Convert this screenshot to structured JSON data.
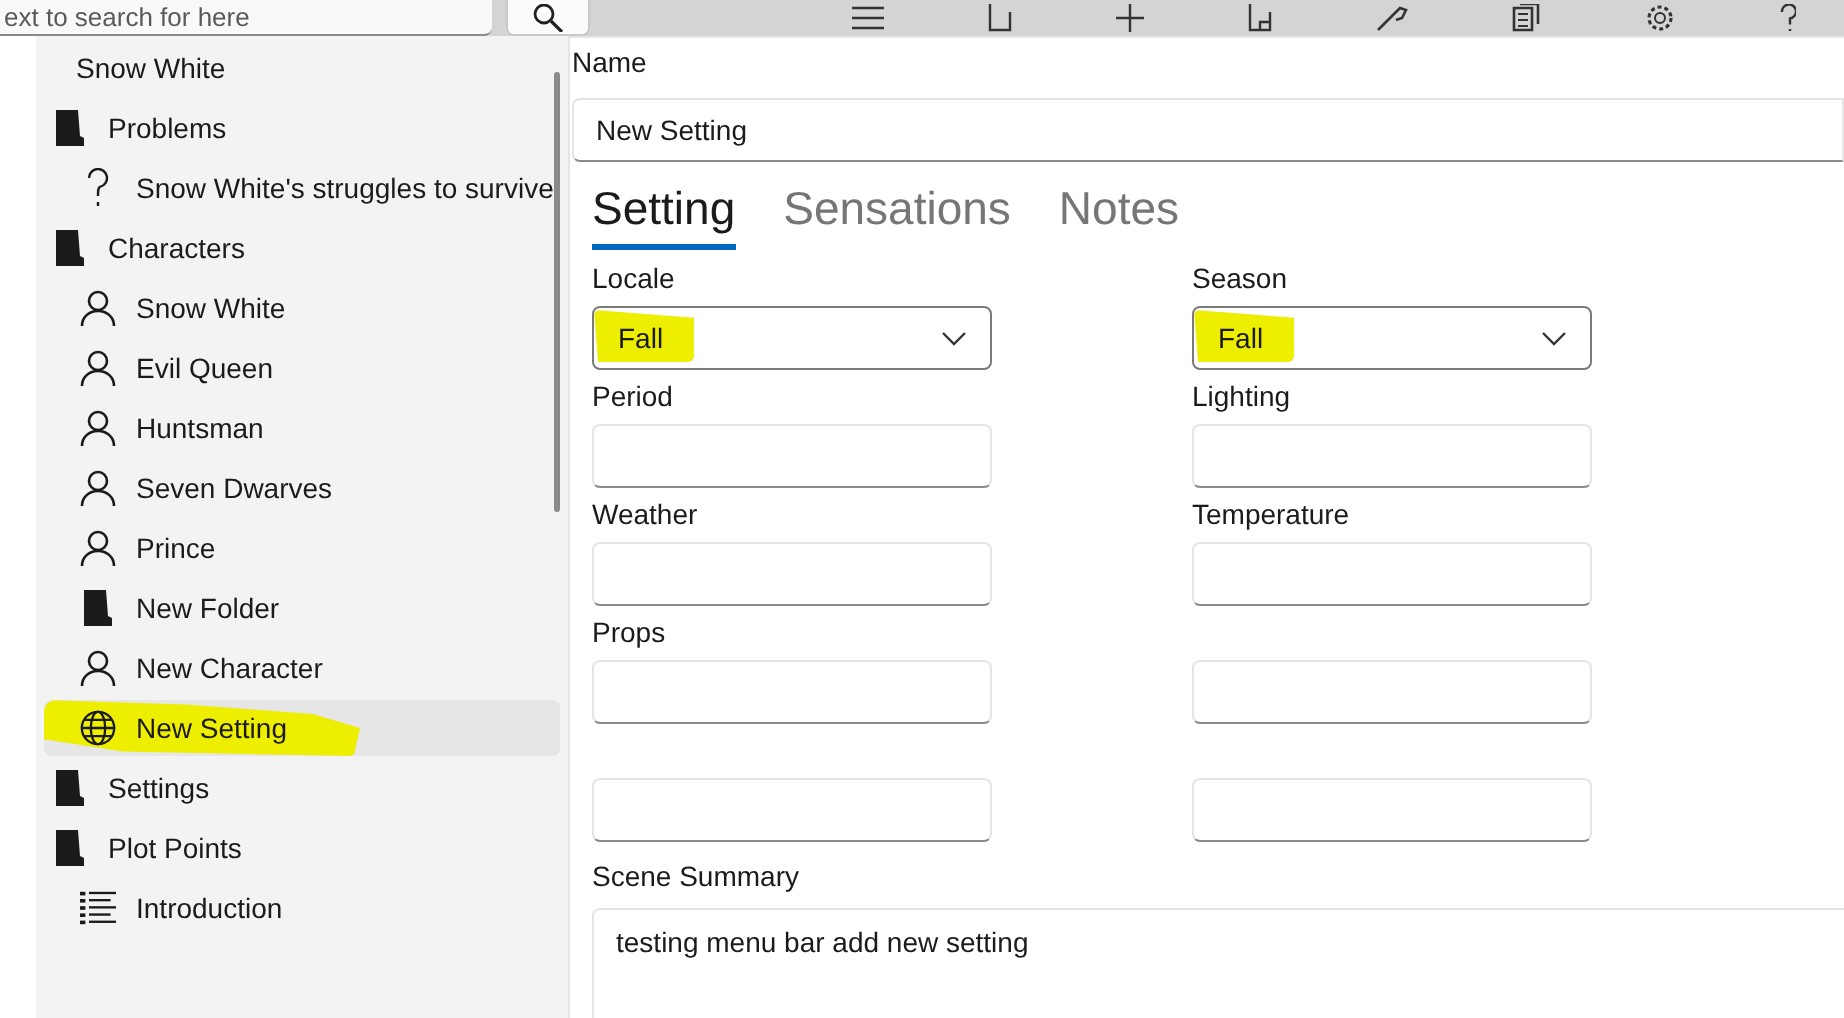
{
  "toolbar": {
    "search": {
      "value": "ext to search for here"
    }
  },
  "tree": {
    "label": "Snow White",
    "selected": false,
    "highlighted": false,
    "children": [
      {
        "kind": "folder",
        "label": "Problems",
        "selected": false,
        "highlighted": false,
        "children": [
          {
            "kind": "problem",
            "label": "Snow White's struggles to survive",
            "selected": false,
            "highlighted": false
          }
        ]
      },
      {
        "kind": "folder",
        "label": "Characters",
        "selected": false,
        "highlighted": false,
        "children": [
          {
            "kind": "character",
            "label": "Snow White",
            "selected": false,
            "highlighted": false
          },
          {
            "kind": "character",
            "label": "Evil Queen",
            "selected": false,
            "highlighted": false
          },
          {
            "kind": "character",
            "label": "Huntsman",
            "selected": false,
            "highlighted": false
          },
          {
            "kind": "character",
            "label": "Seven Dwarves",
            "selected": false,
            "highlighted": false
          },
          {
            "kind": "character",
            "label": "Prince",
            "selected": false,
            "highlighted": false
          },
          {
            "kind": "folder",
            "label": "New Folder",
            "selected": false,
            "highlighted": false
          },
          {
            "kind": "character",
            "label": "New Character",
            "selected": false,
            "highlighted": false
          },
          {
            "kind": "setting",
            "label": "New Setting",
            "selected": true,
            "highlighted": true
          }
        ]
      },
      {
        "kind": "folder",
        "label": "Settings",
        "selected": false,
        "highlighted": false
      },
      {
        "kind": "folder",
        "label": "Plot Points",
        "selected": false,
        "highlighted": false,
        "children": [
          {
            "kind": "plot-point",
            "label": "Introduction",
            "selected": false,
            "highlighted": false
          }
        ]
      }
    ]
  },
  "editor": {
    "name_label": "Name",
    "name_value": "New Setting",
    "tabs": [
      {
        "label": "Setting",
        "selected": true
      },
      {
        "label": "Sensations",
        "selected": false
      },
      {
        "label": "Notes",
        "selected": false
      }
    ],
    "fields": [
      {
        "kind": "dropdown",
        "label": "Locale",
        "value": "Fall",
        "highlighted": true
      },
      {
        "kind": "dropdown",
        "label": "Season",
        "value": "Fall",
        "highlighted": true
      },
      {
        "kind": "text",
        "label": "Period"
      },
      {
        "kind": "text",
        "label": "Lighting"
      },
      {
        "kind": "text",
        "label": "Weather"
      },
      {
        "kind": "text",
        "label": "Temperature"
      },
      {
        "kind": "text",
        "label": "Props"
      },
      {
        "kind": "text"
      },
      {
        "kind": "text"
      },
      {
        "kind": "text"
      }
    ],
    "summary_label": "Scene Summary",
    "summary_value": "testing menu bar add new setting"
  }
}
